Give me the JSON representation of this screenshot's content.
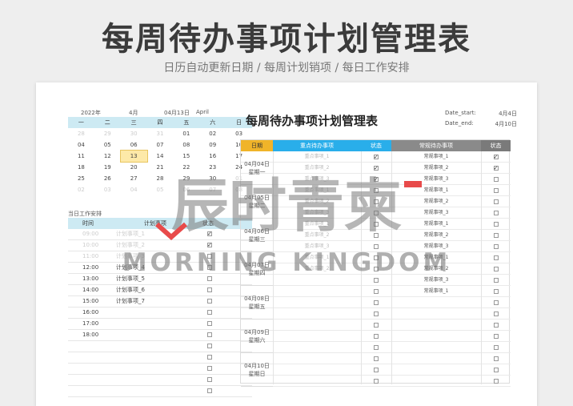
{
  "banner": {
    "title": "每周待办事项计划管理表",
    "subtitle": "日历自动更新日期 / 每周计划销项 / 每日工作安排"
  },
  "calendar": {
    "year": "2022年",
    "month": "4月",
    "date": "04月13日",
    "month_en": "April",
    "weekdays": [
      "一",
      "二",
      "三",
      "四",
      "五",
      "六",
      "日"
    ],
    "rows": [
      [
        "28",
        "29",
        "30",
        "31",
        "01",
        "02",
        "03"
      ],
      [
        "04",
        "05",
        "06",
        "07",
        "08",
        "09",
        "10"
      ],
      [
        "11",
        "12",
        "13",
        "14",
        "15",
        "16",
        "17"
      ],
      [
        "18",
        "19",
        "20",
        "21",
        "22",
        "23",
        "24"
      ],
      [
        "25",
        "26",
        "27",
        "28",
        "29",
        "30",
        "01"
      ],
      [
        "02",
        "03",
        "04",
        "05",
        "06",
        "07",
        "08"
      ]
    ],
    "today": "13"
  },
  "agenda": {
    "title": "当日工作安排",
    "headers": {
      "time": "时间",
      "item": "计划事项",
      "status": "状态"
    },
    "rows": [
      {
        "time": "09:00",
        "item": "计划事项_1",
        "checked": true
      },
      {
        "time": "10:00",
        "item": "计划事项_2",
        "checked": true
      },
      {
        "time": "11:00",
        "item": "计划事项_3",
        "checked": false
      },
      {
        "time": "12:00",
        "item": "计划事项_4",
        "checked": false
      },
      {
        "time": "13:00",
        "item": "计划事项_5",
        "checked": false
      },
      {
        "time": "14:00",
        "item": "计划事项_6",
        "checked": false
      },
      {
        "time": "15:00",
        "item": "计划事项_7",
        "checked": false
      },
      {
        "time": "16:00",
        "item": "",
        "checked": false
      },
      {
        "time": "17:00",
        "item": "",
        "checked": false
      },
      {
        "time": "18:00",
        "item": "",
        "checked": false
      },
      {
        "time": "",
        "item": "",
        "checked": false
      },
      {
        "time": "",
        "item": "",
        "checked": false
      },
      {
        "time": "",
        "item": "",
        "checked": false
      },
      {
        "time": "",
        "item": "",
        "checked": false
      },
      {
        "time": "",
        "item": "",
        "checked": false
      }
    ]
  },
  "weekly": {
    "title": "每周待办事项计划管理表",
    "date_start_label": "Date_start:",
    "date_start": "4月4日",
    "date_end_label": "Date_end:",
    "date_end": "4月10日",
    "headers": {
      "date": "日期",
      "important": "重点待办事项",
      "important_status": "状态",
      "regular": "常规待办事项",
      "regular_status": "状态"
    },
    "days": [
      {
        "date": "04月04日",
        "weekday": "星期一"
      },
      {
        "date": "04月05日",
        "weekday": "星期二"
      },
      {
        "date": "04月06日",
        "weekday": "星期三"
      },
      {
        "date": "04月07日",
        "weekday": "星期四"
      },
      {
        "date": "04月08日",
        "weekday": "星期五"
      },
      {
        "date": "04月09日",
        "weekday": "星期六"
      },
      {
        "date": "04月10日",
        "weekday": "星期日"
      }
    ],
    "rows": [
      {
        "important": "重点事项_1",
        "imp_checked": true,
        "regular": "常规事项_1",
        "reg_checked": true
      },
      {
        "important": "重点事项_2",
        "imp_checked": true,
        "regular": "常规事项_2",
        "reg_checked": true
      },
      {
        "important": "重点事项_3",
        "imp_checked": true,
        "regular": "常规事项_3",
        "reg_checked": false
      },
      {
        "important": "重点事项_1",
        "imp_checked": false,
        "regular": "常规事项_1",
        "reg_checked": false
      },
      {
        "important": "重点事项_2",
        "imp_checked": false,
        "regular": "常规事项_2",
        "reg_checked": false
      },
      {
        "important": "重点事项_3",
        "imp_checked": false,
        "regular": "常规事项_3",
        "reg_checked": false
      },
      {
        "important": "重点事项_1",
        "imp_checked": false,
        "regular": "常规事项_1",
        "reg_checked": false
      },
      {
        "important": "重点事项_2",
        "imp_checked": false,
        "regular": "常规事项_2",
        "reg_checked": false
      },
      {
        "important": "重点事项_3",
        "imp_checked": false,
        "regular": "常规事项_3",
        "reg_checked": false
      },
      {
        "important": "重点事项_1",
        "imp_checked": false,
        "regular": "常规事项_1",
        "reg_checked": false
      },
      {
        "important": "重点事项_2",
        "imp_checked": false,
        "regular": "常规事项_2",
        "reg_checked": false
      },
      {
        "important": "",
        "imp_checked": false,
        "regular": "常规事项_3",
        "reg_checked": false
      },
      {
        "important": "",
        "imp_checked": false,
        "regular": "常规事项_1",
        "reg_checked": false
      },
      {
        "important": "",
        "imp_checked": false,
        "regular": "",
        "reg_checked": false
      },
      {
        "important": "",
        "imp_checked": false,
        "regular": "",
        "reg_checked": false
      },
      {
        "important": "",
        "imp_checked": false,
        "regular": "",
        "reg_checked": false
      },
      {
        "important": "",
        "imp_checked": false,
        "regular": "",
        "reg_checked": false
      },
      {
        "important": "",
        "imp_checked": false,
        "regular": "",
        "reg_checked": false
      },
      {
        "important": "",
        "imp_checked": false,
        "regular": "",
        "reg_checked": false
      },
      {
        "important": "",
        "imp_checked": false,
        "regular": "",
        "reg_checked": false
      },
      {
        "important": "",
        "imp_checked": false,
        "regular": "",
        "reg_checked": false
      }
    ]
  },
  "watermark": {
    "text_cn": "辰时青柬",
    "text_en": "MORNING KINGDOM"
  },
  "colors": {
    "date_header": "#f0b429",
    "important_header": "#29aeea",
    "regular_header": "#8a8a8a",
    "calendar_header": "#cdeaf3",
    "today_highlight": "#fde9a8"
  }
}
